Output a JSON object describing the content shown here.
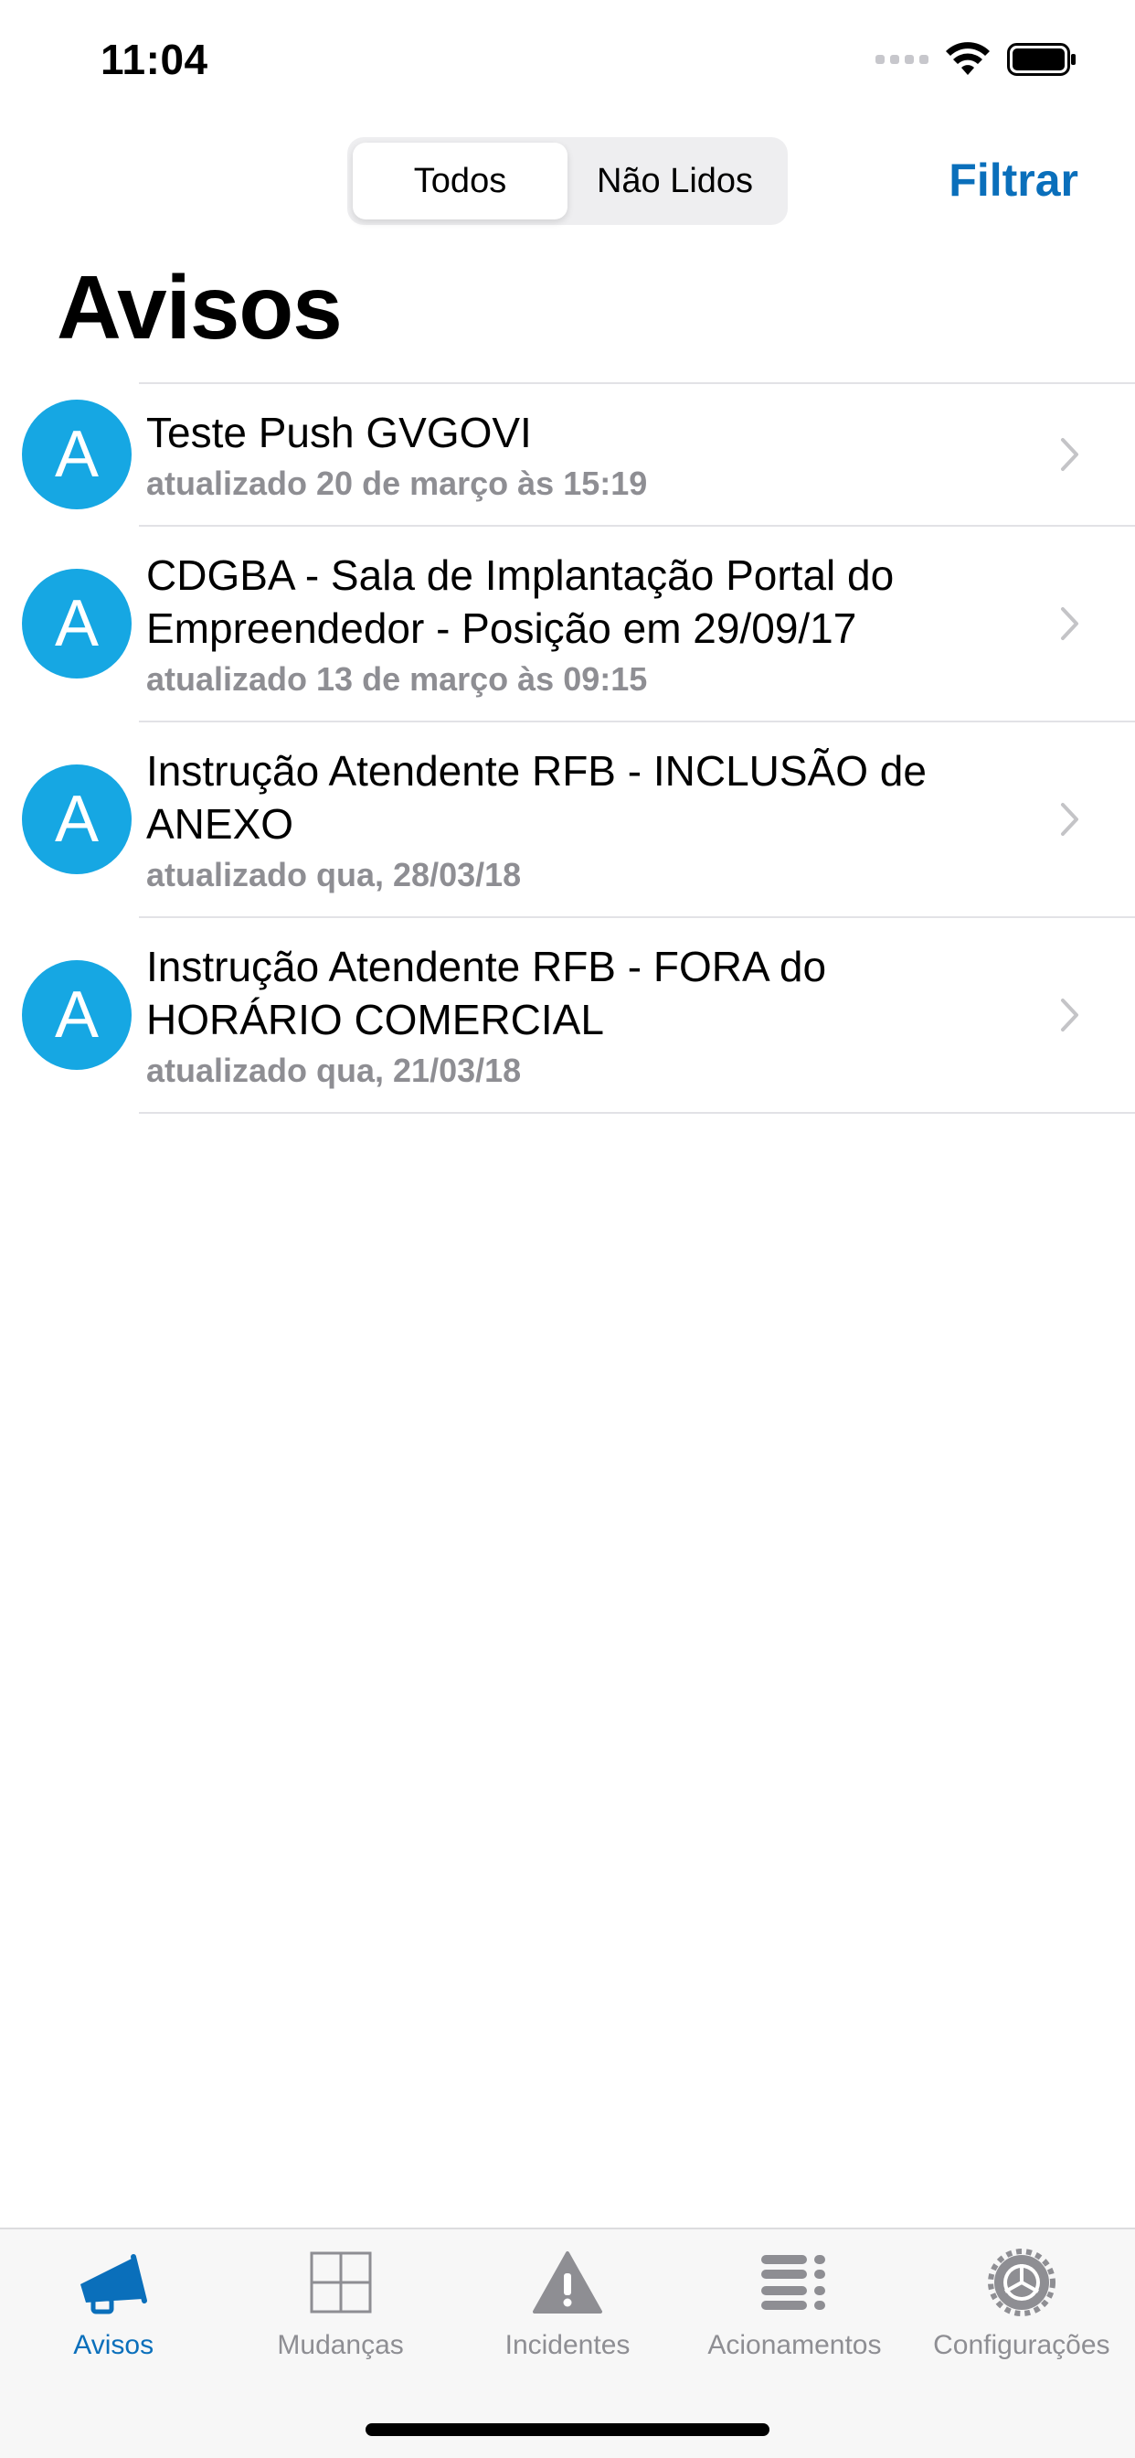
{
  "status_bar": {
    "time": "11:04",
    "wifi_icon": "wifi-icon",
    "battery_icon": "battery-icon"
  },
  "nav": {
    "segments": [
      {
        "label": "Todos",
        "selected": true
      },
      {
        "label": "Não Lidos",
        "selected": false
      }
    ],
    "filter_label": "Filtrar"
  },
  "page": {
    "title": "Avisos"
  },
  "notices": [
    {
      "avatar_letter": "A",
      "title": "Teste Push GVGOVI",
      "subtitle": "atualizado 20 de março às 15:19"
    },
    {
      "avatar_letter": "A",
      "title": "CDGBA - Sala de Implantação Portal do Empreendedor - Posição em 29/09/17",
      "subtitle": "atualizado 13 de março às 09:15"
    },
    {
      "avatar_letter": "A",
      "title": "Instrução Atendente RFB - INCLUSÃO de ANEXO",
      "subtitle": "atualizado qua, 28/03/18"
    },
    {
      "avatar_letter": "A",
      "title": "Instrução Atendente RFB - FORA do HORÁRIO COMERCIAL",
      "subtitle": "atualizado qua, 21/03/18"
    }
  ],
  "tab_bar": {
    "tabs": [
      {
        "label": "Avisos",
        "icon": "megaphone-icon",
        "active": true
      },
      {
        "label": "Mudanças",
        "icon": "grid-icon",
        "active": false
      },
      {
        "label": "Incidentes",
        "icon": "warning-icon",
        "active": false
      },
      {
        "label": "Acionamentos",
        "icon": "list-icon",
        "active": false
      },
      {
        "label": "Configurações",
        "icon": "gear-icon",
        "active": false
      }
    ]
  },
  "colors": {
    "accent": "#0a6fbb",
    "avatar": "#16a7e3",
    "secondary_text": "#8e8e93"
  }
}
